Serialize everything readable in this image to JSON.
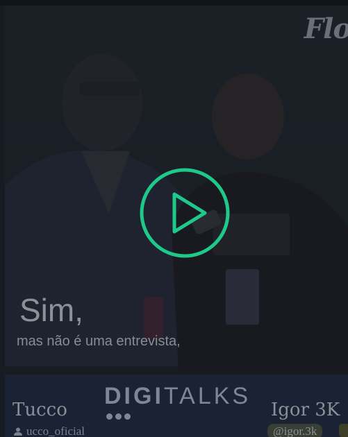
{
  "caption": {
    "main": "Sim,",
    "sub": "mas não é uma entrevista,"
  },
  "brand": {
    "bold": "DIGI",
    "light": "TALKS"
  },
  "corner_logo": "Flo",
  "guests": {
    "left": {
      "name": "Tucco",
      "handle": "ucco_oficial"
    },
    "right": {
      "name": "Igor 3K",
      "handle": "@igor.3k"
    }
  },
  "colors": {
    "play_accent": "#1fc98a",
    "band": "#1b2233",
    "overlay": "#161b21"
  },
  "icons": {
    "play": "play-icon",
    "person": "person-icon"
  }
}
